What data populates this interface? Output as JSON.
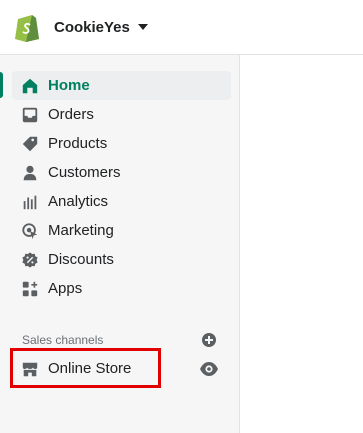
{
  "header": {
    "store_name": "CookieYes"
  },
  "nav": {
    "items": [
      {
        "label": "Home",
        "icon": "home-icon",
        "active": true
      },
      {
        "label": "Orders",
        "icon": "inbox-icon",
        "active": false
      },
      {
        "label": "Products",
        "icon": "tag-icon",
        "active": false
      },
      {
        "label": "Customers",
        "icon": "person-icon",
        "active": false
      },
      {
        "label": "Analytics",
        "icon": "bar-chart-icon",
        "active": false
      },
      {
        "label": "Marketing",
        "icon": "target-icon",
        "active": false
      },
      {
        "label": "Discounts",
        "icon": "discount-icon",
        "active": false
      },
      {
        "label": "Apps",
        "icon": "apps-grid-icon",
        "active": false
      }
    ]
  },
  "sales_channels": {
    "title": "Sales channels",
    "items": [
      {
        "label": "Online Store",
        "icon": "store-icon",
        "action_icon": "eye-icon"
      }
    ],
    "add_icon": "plus-circle-icon"
  },
  "colors": {
    "accent": "#008060",
    "active_bg": "#edeeef",
    "sidebar_bg": "#f6f6f7",
    "highlight": "#e30000",
    "icon": "#5c5f62"
  }
}
